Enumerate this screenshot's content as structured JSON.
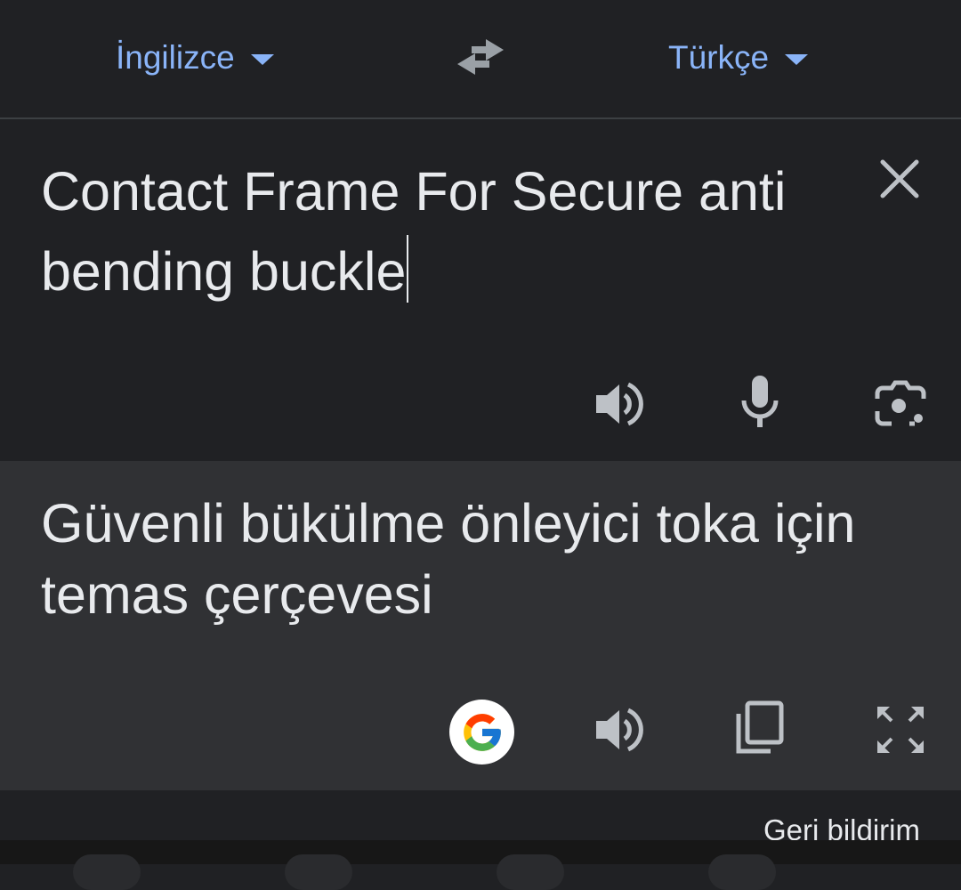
{
  "language_bar": {
    "source_language": "İngilizce",
    "target_language": "Türkçe",
    "swap_icon": "swap-horizontal-icon"
  },
  "input": {
    "text": "Contact Frame For Secure anti bending buckle",
    "clear_icon": "close-icon",
    "actions": [
      "speaker-icon",
      "microphone-icon",
      "camera-icon"
    ]
  },
  "output": {
    "text": "Güvenli bükülme önleyici toka için temas çerçevesi",
    "actions": [
      "google-icon",
      "speaker-icon",
      "copy-icon",
      "fullscreen-icon"
    ]
  },
  "footer": {
    "feedback_label": "Geri bildirim"
  },
  "colors": {
    "background": "#202124",
    "output_background": "#303134",
    "accent": "#8ab4f8",
    "icon": "#bdc1c6",
    "text": "#e8eaed"
  }
}
